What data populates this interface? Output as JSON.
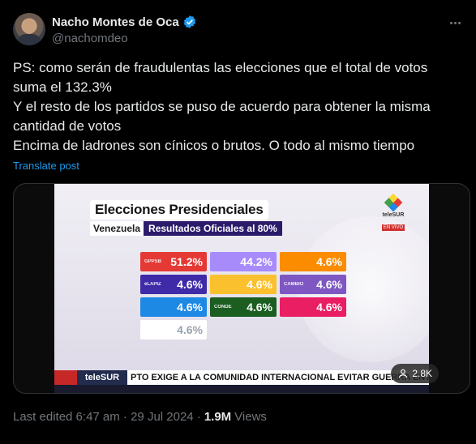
{
  "author": {
    "display_name": "Nacho Montes de Oca",
    "handle": "@nachomdeo"
  },
  "tweet": {
    "lines": [
      "PS: como serán de fraudulentas las elecciones que el total de votos suma el 132.3%",
      "Y el resto de los partidos se puso de acuerdo para obtener la misma cantidad de votos",
      "Encima de ladrones son cínicos o brutos. O todo al mismo tiempo"
    ],
    "translate_label": "Translate post"
  },
  "media": {
    "title": "Elecciones Presidenciales",
    "country": "Venezuela",
    "result_label": "Resultados Oficiales al 80%",
    "channel_logo_text": "teleSUR",
    "live_label": "EN VIVO",
    "ticker_brand": "teleSUR",
    "ticker_text": "PTO EXIGE A LA COMUNIDAD INTERNACIONAL EVITAR GUERRA ENTRE IS",
    "view_count": "2.8K",
    "tiles": [
      {
        "party": "GPPSB",
        "pct": "51.2%",
        "color": "#e53935"
      },
      {
        "party": "",
        "pct": "44.2%",
        "color": "#a78bfa"
      },
      {
        "party": "",
        "pct": "4.6%",
        "color": "#fb8c00"
      },
      {
        "party": "eLAPIZ",
        "pct": "4.6%",
        "color": "#3f2aa8"
      },
      {
        "party": "",
        "pct": "4.6%",
        "color": "#fbc02d"
      },
      {
        "party": "CAMBIO",
        "pct": "4.6%",
        "color": "#7e57c2"
      },
      {
        "party": "",
        "pct": "4.6%",
        "color": "#1e88e5"
      },
      {
        "party": "CONDE",
        "pct": "4.6%",
        "color": "#1b5e20"
      },
      {
        "party": "",
        "pct": "4.6%",
        "color": "#e91e63"
      },
      {
        "party": "",
        "pct": "4.6%",
        "color": "#ffffff"
      }
    ]
  },
  "meta": {
    "edited": "Last edited 6:47 am · 29 Jul 2024 ·",
    "views_count": "1.9M",
    "views_label": "Views"
  },
  "colors": {
    "background": "#000000",
    "link": "#1d9bf0",
    "muted": "#71767b",
    "text": "#e7e9ea"
  }
}
